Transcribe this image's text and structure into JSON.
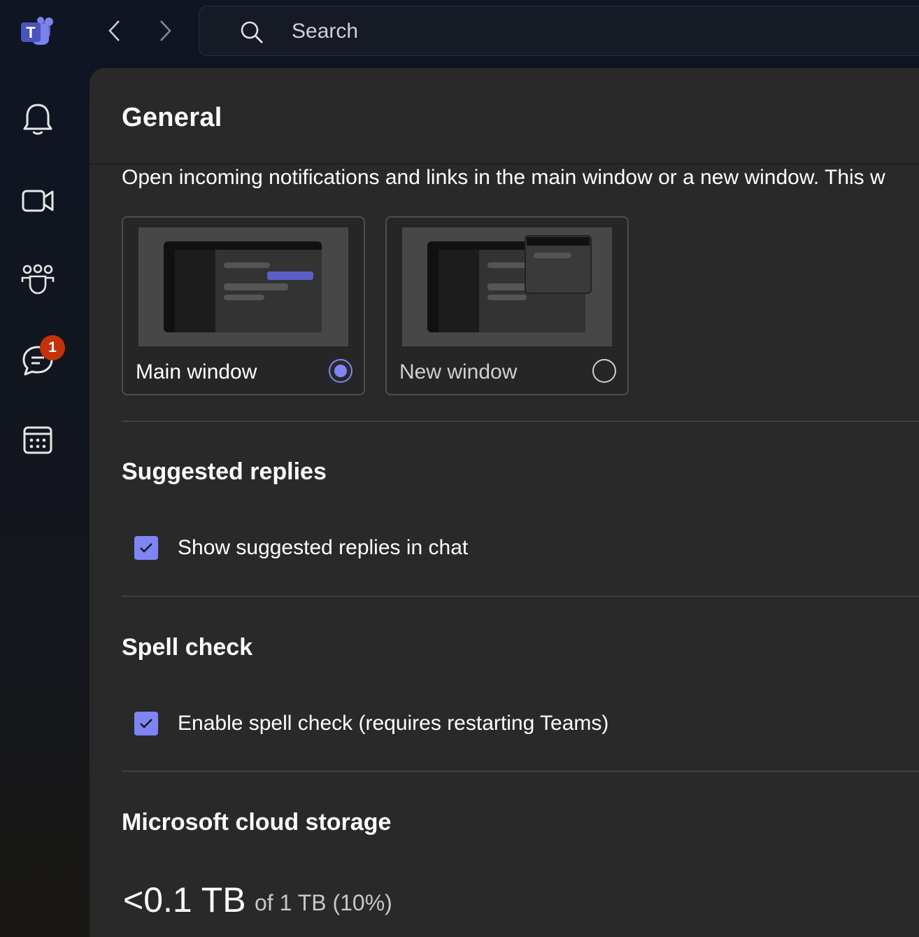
{
  "search": {
    "placeholder": "Search"
  },
  "settings": {
    "title": "General",
    "open_links": {
      "description": "Open incoming notifications and links in the main window or a new window. This w",
      "options": [
        {
          "label": "Main window",
          "selected": true
        },
        {
          "label": "New window",
          "selected": false
        }
      ]
    },
    "suggested_replies": {
      "title": "Suggested replies",
      "checkbox_label": "Show suggested replies in chat",
      "checked": true
    },
    "spell_check": {
      "title": "Spell check",
      "checkbox_label": "Enable spell check (requires restarting Teams)",
      "checked": true
    },
    "cloud_storage": {
      "title": "Microsoft cloud storage",
      "used": "<0.1 TB",
      "total": "of 1 TB (10%)"
    }
  },
  "rail": {
    "chat_badge": "1"
  },
  "colors": {
    "accent": "#7f85f5",
    "badge": "#c4320a",
    "panel": "#292929"
  }
}
